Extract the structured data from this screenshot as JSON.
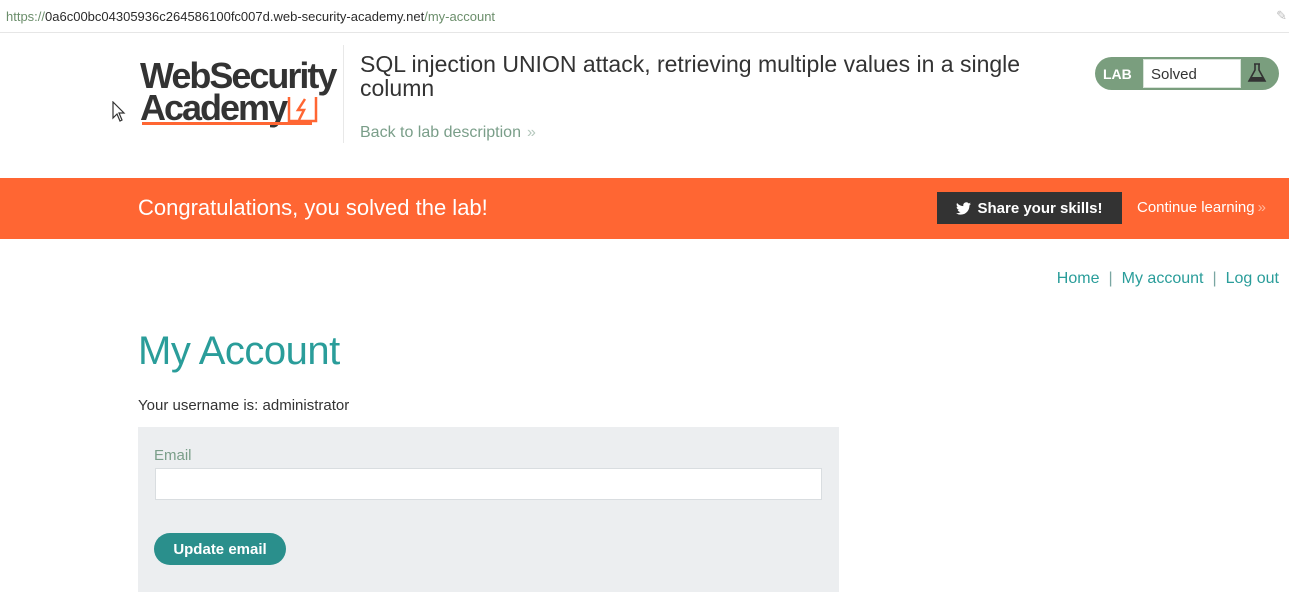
{
  "browser": {
    "url_scheme": "https://",
    "url_host": "0a6c00bc04305936c264586100fc007d.web-security-academy.net",
    "url_path": "/my-account"
  },
  "header": {
    "logo_line1": "WebSecurity",
    "logo_line2": "Academy",
    "lab_title": "SQL injection UNION attack, retrieving multiple values in a single column",
    "back_link": "Back to lab description",
    "lab_badge_label": "LAB",
    "lab_status": "Solved"
  },
  "banner": {
    "message": "Congratulations, you solved the lab!",
    "share_button": "Share your skills!",
    "continue_link": "Continue learning"
  },
  "nav": {
    "items": [
      {
        "label": "Home"
      },
      {
        "label": "My account"
      },
      {
        "label": "Log out"
      }
    ],
    "separator": "|"
  },
  "main": {
    "title": "My Account",
    "username_line": "Your username is: administrator",
    "email_label": "Email",
    "email_value": "",
    "update_button": "Update email"
  },
  "colors": {
    "accent_orange": "#ff6633",
    "teal": "#2a9d9a",
    "lab_badge_green": "#7a9e7e",
    "dark_button": "#333333"
  }
}
